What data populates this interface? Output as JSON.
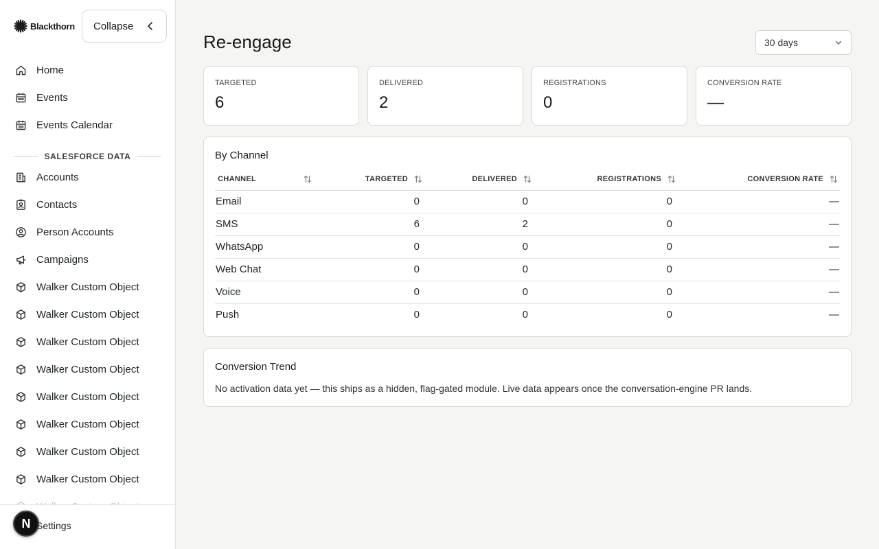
{
  "brand": {
    "name": "Blackthorn"
  },
  "sidebar": {
    "collapse_label": "Collapse",
    "nav_main": [
      {
        "label": "Home",
        "icon": "home-icon"
      },
      {
        "label": "Events",
        "icon": "calendar-icon"
      },
      {
        "label": "Events Calendar",
        "icon": "calendar-grid-icon"
      }
    ],
    "section_label": "SALESFORCE DATA",
    "nav_data": [
      {
        "label": "Accounts",
        "icon": "building-icon"
      },
      {
        "label": "Contacts",
        "icon": "contact-card-icon"
      },
      {
        "label": "Person Accounts",
        "icon": "user-circle-icon"
      },
      {
        "label": "Campaigns",
        "icon": "megaphone-icon"
      },
      {
        "label": "Walker Custom Object",
        "icon": "cube-icon"
      },
      {
        "label": "Walker Custom Object",
        "icon": "cube-icon"
      },
      {
        "label": "Walker Custom Object",
        "icon": "cube-icon"
      },
      {
        "label": "Walker Custom Object",
        "icon": "cube-icon"
      },
      {
        "label": "Walker Custom Object",
        "icon": "cube-icon"
      },
      {
        "label": "Walker Custom Object",
        "icon": "cube-icon"
      },
      {
        "label": "Walker Custom Object",
        "icon": "cube-icon"
      },
      {
        "label": "Walker Custom Object",
        "icon": "cube-icon"
      },
      {
        "label": "Walker Custom Object",
        "icon": "cube-icon"
      }
    ],
    "settings_label": "Settings",
    "avatar_letter": "N"
  },
  "main": {
    "title": "Re-engage",
    "range_value": "30 days",
    "stats": [
      {
        "label": "TARGETED",
        "value": "6"
      },
      {
        "label": "DELIVERED",
        "value": "2"
      },
      {
        "label": "REGISTRATIONS",
        "value": "0"
      },
      {
        "label": "CONVERSION RATE",
        "value": "—"
      }
    ],
    "by_channel": {
      "title": "By Channel",
      "columns": [
        "CHANNEL",
        "TARGETED",
        "DELIVERED",
        "REGISTRATIONS",
        "CONVERSION RATE"
      ],
      "rows": [
        [
          "Email",
          "0",
          "0",
          "0",
          "—"
        ],
        [
          "SMS",
          "6",
          "2",
          "0",
          "—"
        ],
        [
          "WhatsApp",
          "0",
          "0",
          "0",
          "—"
        ],
        [
          "Web Chat",
          "0",
          "0",
          "0",
          "—"
        ],
        [
          "Voice",
          "0",
          "0",
          "0",
          "—"
        ],
        [
          "Push",
          "0",
          "0",
          "0",
          "—"
        ]
      ]
    },
    "trend": {
      "title": "Conversion Trend",
      "message": "No activation data yet — this ships as a hidden, flag-gated module. Live data appears once the conversation-engine PR lands."
    }
  }
}
